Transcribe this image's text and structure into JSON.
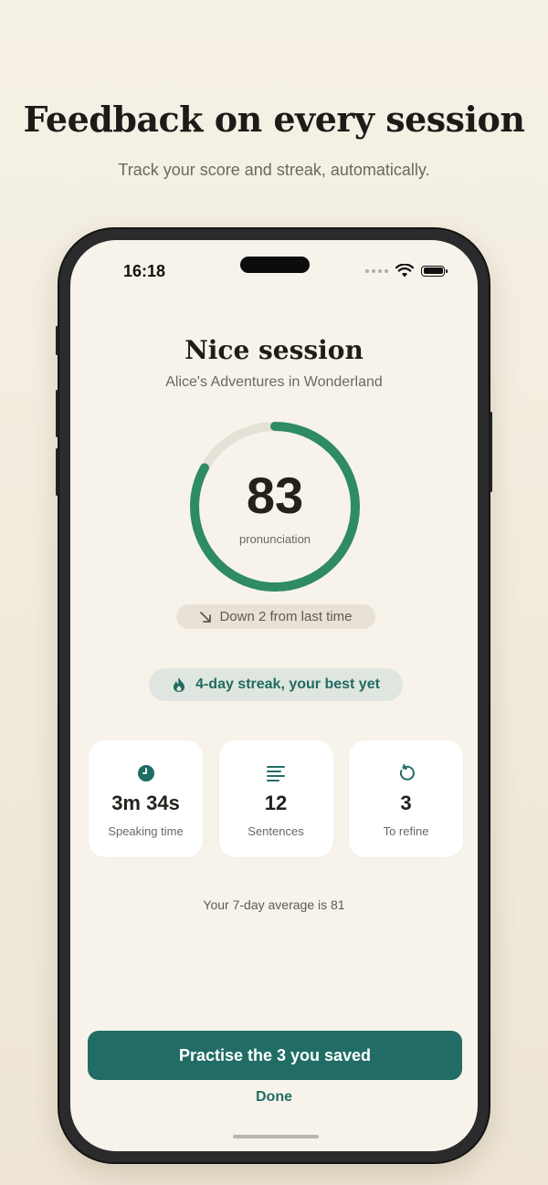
{
  "marketing": {
    "headline": "Feedback on every session",
    "subhead": "Track your score and streak, automatically."
  },
  "status_bar": {
    "time": "16:18",
    "icons": [
      "signal-dots-icon",
      "wifi-icon",
      "battery-icon"
    ]
  },
  "session": {
    "title": "Nice session",
    "book": "Alice's Adventures in Wonderland"
  },
  "score": {
    "value": "83",
    "label": "pronunciation",
    "ring_fraction": 0.83,
    "ring_color": "#2e8b63",
    "track_color": "#e6e1d6"
  },
  "trend": {
    "icon": "arrow-down-right-icon",
    "text": "Down 2 from last time"
  },
  "streak": {
    "icon": "flame-icon",
    "text": "4-day streak, your best yet"
  },
  "stats": [
    {
      "icon": "clock-icon",
      "value": "3m 34s",
      "label": "Speaking time"
    },
    {
      "icon": "lines-icon",
      "value": "12",
      "label": "Sentences"
    },
    {
      "icon": "refresh-icon",
      "value": "3",
      "label": "To refine"
    }
  ],
  "average_text": "Your 7-day average is 81",
  "actions": {
    "primary": "Practise the 3 you saved",
    "secondary": "Done"
  },
  "colors": {
    "accent": "#216d66",
    "ring": "#2e8b63",
    "background": "#f7f3ea"
  }
}
